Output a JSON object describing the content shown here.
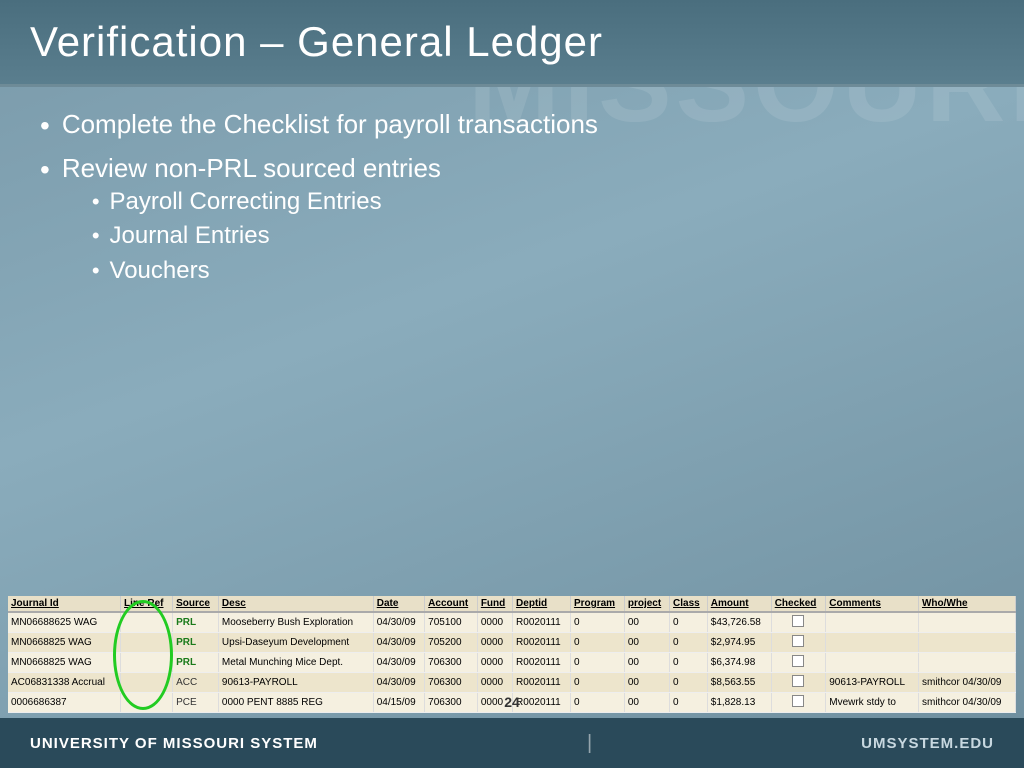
{
  "header": {
    "title": "Verification – General Ledger",
    "watermark": "MISSOURI"
  },
  "bullets": [
    {
      "text": "Complete the Checklist for payroll transactions",
      "sub": []
    },
    {
      "text": "Review non-PRL sourced entries",
      "sub": [
        "Payroll Correcting Entries",
        "Journal Entries",
        "Vouchers"
      ]
    }
  ],
  "table": {
    "columns": [
      "Journal Id",
      "Line Ref",
      "Source",
      "Desc",
      "Date",
      "Account",
      "Fund",
      "Deptid",
      "Program",
      "project",
      "Class",
      "Amount",
      "Checked",
      "Comments",
      "Who/Whe"
    ],
    "rows": [
      {
        "journal_id": "MN06688625 WAG",
        "line_ref": "",
        "source": "PRL",
        "source_type": "prl",
        "desc": "Mooseberry Bush Exploration",
        "date": "04/30/09",
        "account": "705100",
        "fund": "0000",
        "deptid": "R0020111",
        "program": "0",
        "project": "00",
        "class": "0",
        "amount": "$43,726.58",
        "checked": false,
        "comments": "",
        "who_whe": ""
      },
      {
        "journal_id": "MN0668825 WAG",
        "line_ref": "",
        "source": "PRL",
        "source_type": "prl",
        "desc": "Upsi-Daseyum Development",
        "date": "04/30/09",
        "account": "705200",
        "fund": "0000",
        "deptid": "R0020111",
        "program": "0",
        "project": "00",
        "class": "0",
        "amount": "$2,974.95",
        "checked": false,
        "comments": "",
        "who_whe": ""
      },
      {
        "journal_id": "MN0668825 WAG",
        "line_ref": "",
        "source": "PRL",
        "source_type": "prl",
        "desc": "Metal Munching Mice Dept.",
        "date": "04/30/09",
        "account": "706300",
        "fund": "0000",
        "deptid": "R0020111",
        "program": "0",
        "project": "00",
        "class": "0",
        "amount": "$6,374.98",
        "checked": false,
        "comments": "",
        "who_whe": ""
      },
      {
        "journal_id": "AC06831338 Accrual",
        "line_ref": "",
        "source": "ACC",
        "source_type": "acc",
        "desc": "90613-PAYROLL",
        "date": "04/30/09",
        "account": "706300",
        "fund": "0000",
        "deptid": "R0020111",
        "program": "0",
        "project": "00",
        "class": "0",
        "amount": "$8,563.55",
        "checked": false,
        "comments": "90613-PAYROLL",
        "who_whe": "smithcor 04/30/09"
      },
      {
        "journal_id": "0006686387",
        "line_ref": "",
        "source": "PCE",
        "source_type": "pce",
        "desc": "0000 PENT 8885 REG",
        "date": "04/15/09",
        "account": "706300",
        "fund": "0000",
        "deptid": "R0020111",
        "program": "0",
        "project": "00",
        "class": "0",
        "amount": "$1,828.13",
        "checked": false,
        "comments": "Mvewrk stdy to",
        "who_whe": "smithcor 04/30/09"
      }
    ]
  },
  "page_number": "24",
  "footer": {
    "left": "UNIVERSITY OF MISSOURI SYSTEM",
    "right": "UMSYSTEM.EDU"
  }
}
